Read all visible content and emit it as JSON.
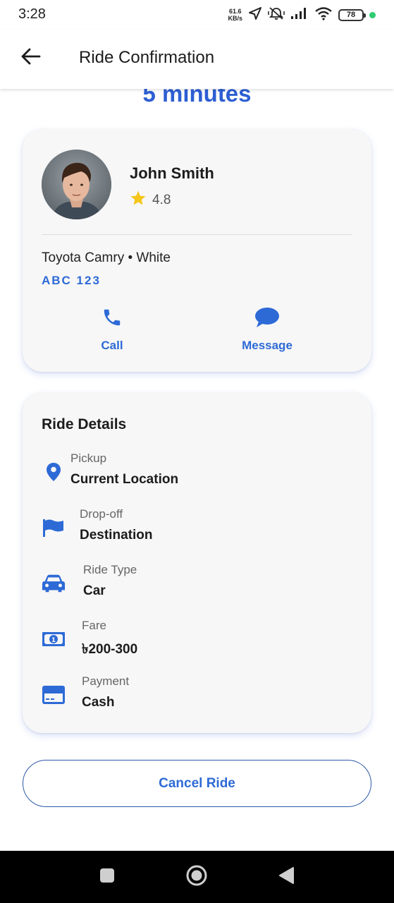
{
  "status_bar": {
    "time": "3:28",
    "net_speed_value": "61.6",
    "net_speed_unit": "KB/s",
    "battery": "78",
    "icons": [
      "location-arrow-icon",
      "mute-vibrate-icon",
      "signal-icon",
      "wifi-icon",
      "battery-icon",
      "notification-dot-icon"
    ]
  },
  "app_bar": {
    "title": "Ride Confirmation",
    "back_icon": "arrow-left-icon"
  },
  "eta": "5 minutes",
  "driver": {
    "name": "John Smith",
    "rating": "4.8",
    "vehicle": "Toyota Camry • White",
    "plate": "ABC 123",
    "actions": [
      {
        "label": "Call",
        "icon": "phone-icon"
      },
      {
        "label": "Message",
        "icon": "chat-bubble-icon"
      }
    ]
  },
  "ride_details": {
    "title": "Ride Details",
    "rows": [
      {
        "label": "Pickup",
        "value": "Current Location",
        "icon": "location-pin-icon"
      },
      {
        "label": "Drop-off",
        "value": "Destination",
        "icon": "flag-icon"
      },
      {
        "label": "Ride Type",
        "value": "Car",
        "icon": "car-icon"
      },
      {
        "label": "Fare",
        "value": "৳200-300",
        "icon": "banknote-icon"
      },
      {
        "label": "Payment",
        "value": "Cash",
        "icon": "credit-card-icon"
      }
    ]
  },
  "cancel_label": "Cancel Ride",
  "colors": {
    "accent": "#2d6ad6",
    "eta": "#2d5fd3",
    "star": "#f5c518",
    "card_bg": "#f7f7f7"
  },
  "nav_bar": {
    "icons": [
      "recents-square-icon",
      "home-circle-icon",
      "back-triangle-icon"
    ]
  }
}
